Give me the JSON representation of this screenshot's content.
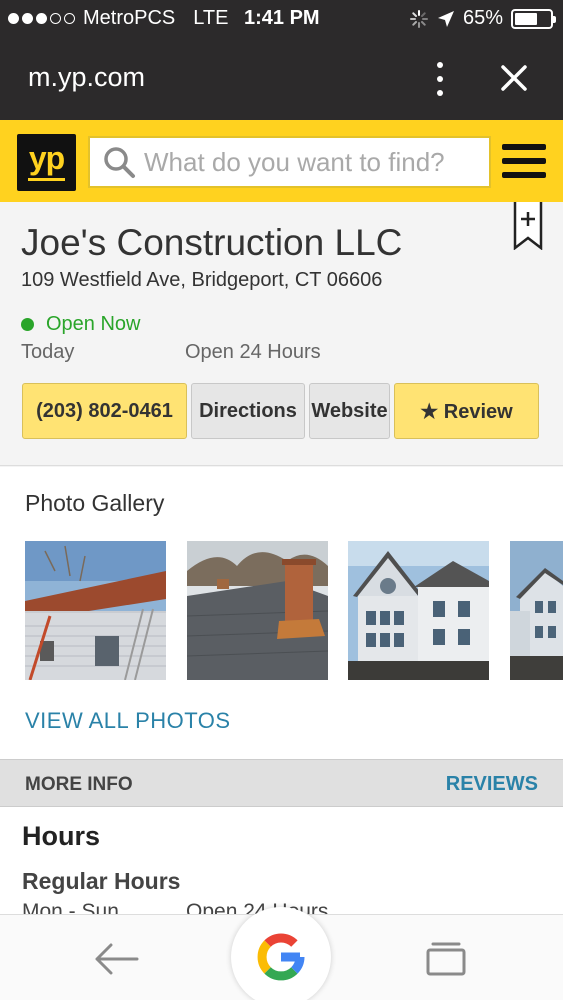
{
  "status_bar": {
    "carrier": "MetroPCS",
    "network": "LTE",
    "time": "1:41 PM",
    "battery": "65%",
    "battery_level": 0.65,
    "signal_bars": 3,
    "signal_total": 5
  },
  "browser": {
    "url": "m.yp.com",
    "menu_icon": "kebab-icon",
    "close_icon": "close-icon"
  },
  "header": {
    "logo": "yp",
    "search_placeholder": "What do you want to find?",
    "search_value": ""
  },
  "business": {
    "name": "Joe's Construction LLC",
    "address": "109 Westfield Ave, Bridgeport, CT 06606",
    "status": "Open Now",
    "today_label": "Today",
    "today_hours": "Open 24 Hours",
    "buttons": {
      "phone": "(203) 802-0461",
      "directions": "Directions",
      "website": "Website",
      "review": "★ Review"
    }
  },
  "gallery": {
    "title": "Photo Gallery",
    "view_all": "VIEW ALL PHOTOS",
    "photos": [
      "house-siding-photo",
      "roof-shingles-photo",
      "house-exterior-photo",
      "house-partial-photo"
    ]
  },
  "more_info": {
    "label": "MORE INFO",
    "reviews_tab": "REVIEWS"
  },
  "hours": {
    "title": "Hours",
    "regular_label": "Regular Hours",
    "days": "Mon - Sun",
    "open": "Open 24 Hours"
  },
  "colors": {
    "yp_yellow": "#ffd21f",
    "open_green": "#2aa52a",
    "link_blue": "#2a82a8",
    "dark_bar": "#2c2a2b"
  }
}
